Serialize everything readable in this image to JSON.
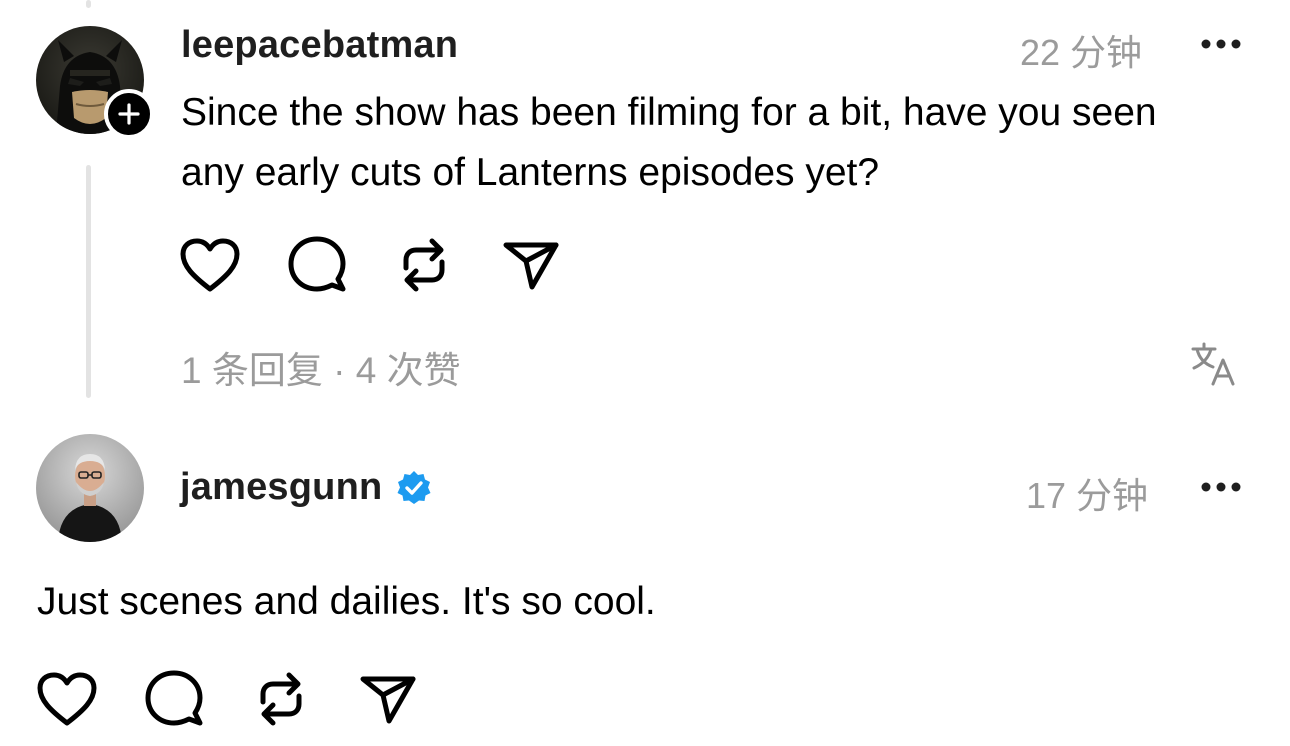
{
  "colors": {
    "text_primary": "#000000",
    "text_secondary": "#9b9b9b",
    "thread_line": "#e3e3e3",
    "verified_badge": "#1d9bf0"
  },
  "post1": {
    "username": "leepacebatman",
    "timestamp": "22 分钟",
    "text": "Since the show has been filming for a bit, have you seen any early cuts of Lanterns episodes yet?",
    "stats": "1 条回复 · 4 次赞",
    "avatar_icon": "batman-avatar",
    "badge_icon": "follow-plus-icon",
    "actions": [
      "heart-icon",
      "comment-icon",
      "repost-icon",
      "share-icon"
    ],
    "more_icon": "more-icon",
    "translate_icon": "translate-icon"
  },
  "post2": {
    "username": "jamesgunn",
    "verified": true,
    "timestamp": "17 分钟",
    "text": "Just scenes and dailies. It's so cool.",
    "avatar_icon": "profile-photo-avatar",
    "actions": [
      "heart-icon",
      "comment-icon",
      "repost-icon",
      "share-icon"
    ],
    "more_icon": "more-icon"
  }
}
